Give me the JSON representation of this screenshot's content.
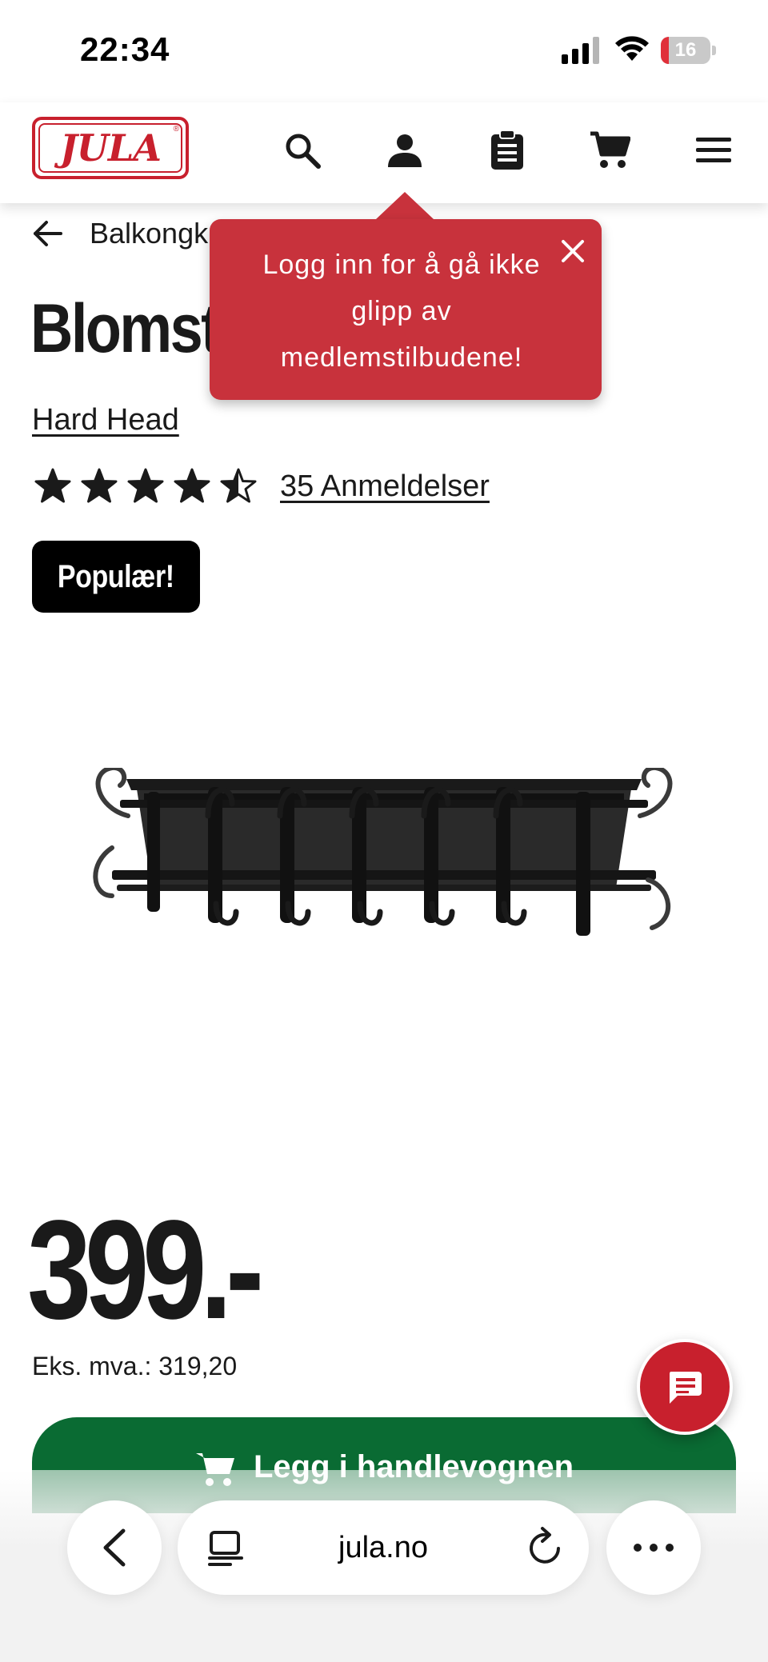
{
  "status_bar": {
    "time": "22:34",
    "battery_level": "16",
    "battery_fraction": 0.16,
    "icons": [
      "cellular-signal-icon",
      "wifi-icon",
      "battery-icon"
    ]
  },
  "header": {
    "logo_text": "JULA",
    "icons": [
      "search-icon",
      "user-icon",
      "clipboard-icon",
      "cart-icon",
      "menu-icon"
    ],
    "brand_color": "#c8202d"
  },
  "breadcrumb": {
    "label": "Balkongk"
  },
  "tooltip": {
    "message": "Logg inn for å gå ikke glipp av medlemstilbudene!",
    "background": "#c8323c"
  },
  "product": {
    "title": "Blomst                    n",
    "brand": "Hard Head",
    "rating": 4.5,
    "rating_max": 5,
    "reviews_label": "35 Anmeldelser",
    "badge": "Populær!",
    "price": "399.-",
    "price_ex_vat": "Eks. mva.: 319,20",
    "add_to_cart_label": "Legg i handlevognen",
    "cart_button_color": "#0a6b33"
  },
  "browser": {
    "url": "jula.no",
    "icons": [
      "back-icon",
      "reader-icon",
      "reload-icon",
      "more-icon"
    ]
  }
}
